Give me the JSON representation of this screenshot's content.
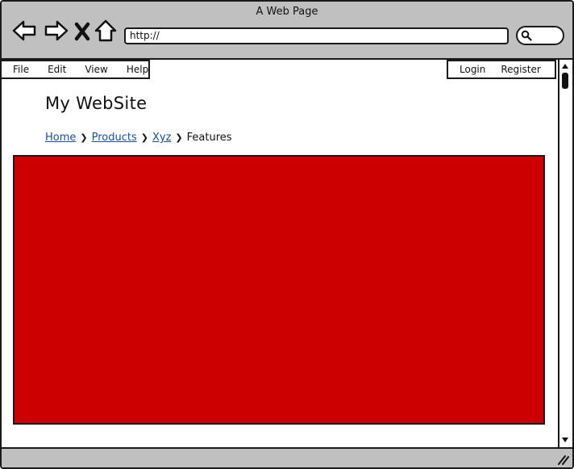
{
  "window": {
    "title": "A Web Page"
  },
  "toolbar": {
    "url": "http://",
    "icons": [
      "back-arrow",
      "forward-arrow",
      "close-x",
      "home-house",
      "search-magnifier"
    ]
  },
  "menu": {
    "items": [
      "File",
      "Edit",
      "View",
      "Help"
    ]
  },
  "auth": {
    "login": "Login",
    "register": "Register"
  },
  "page": {
    "site_title": "My WebSite",
    "breadcrumb": {
      "links": [
        "Home",
        "Products",
        "Xyz"
      ],
      "current": "Features"
    },
    "hero": {
      "color": "#cc0000"
    }
  }
}
